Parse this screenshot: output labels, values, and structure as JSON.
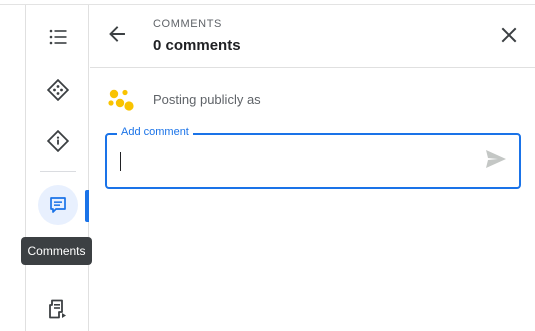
{
  "rail": {
    "items": [
      {
        "icon": "list-icon"
      },
      {
        "icon": "component-icon"
      },
      {
        "icon": "info-diamond-icon"
      },
      {
        "icon": "comment-icon",
        "active": true
      },
      {
        "icon": "queue-video-icon"
      }
    ],
    "tooltip": "Comments",
    "accent": "#1a73e8"
  },
  "panel": {
    "overline": "COMMENTS",
    "title": "0 comments",
    "posting_label": "Posting publicly as",
    "input": {
      "label": "Add comment",
      "value": ""
    }
  },
  "colors": {
    "accent": "#1a73e8",
    "avatar": "#f9c300",
    "tooltip_bg": "#3c4043"
  }
}
